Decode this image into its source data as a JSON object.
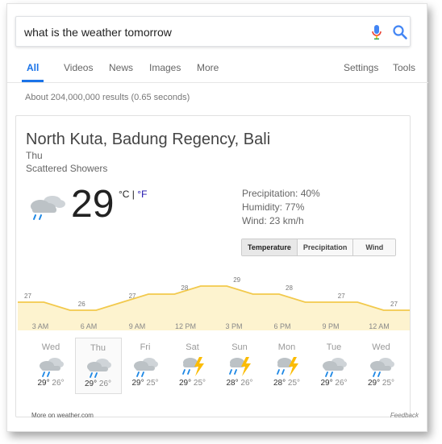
{
  "search": {
    "query": "what is the weather tomorrow"
  },
  "tabs": [
    {
      "label": "All"
    },
    {
      "label": "Videos"
    },
    {
      "label": "News"
    },
    {
      "label": "Images"
    },
    {
      "label": "More"
    }
  ],
  "tools": {
    "settings": "Settings",
    "tools": "Tools"
  },
  "result_stats": "About 204,000,000 results (0.65 seconds)",
  "weather": {
    "location": "North Kuta, Badung Regency, Bali",
    "day": "Thu",
    "condition": "Scattered Showers",
    "temperature": "29",
    "unit_c": "°C",
    "unit_sep": " | ",
    "unit_f": "°F",
    "precipitation": "Precipitation: 40%",
    "humidity": "Humidity: 77%",
    "wind": "Wind: 23 km/h",
    "toggle": [
      "Temperature",
      "Precipitation",
      "Wind"
    ]
  },
  "chart_data": {
    "type": "area",
    "x": [
      "12 AM",
      "3 AM",
      "6 AM",
      "9 AM",
      "12 PM",
      "3 PM",
      "6 PM",
      "9 PM",
      "12 AM"
    ],
    "hourly_temps": [
      27,
      27,
      26,
      26,
      27,
      28,
      28,
      29,
      29,
      28,
      28,
      27,
      27,
      27,
      26,
      26
    ],
    "labels": [
      {
        "hour": "12 AM",
        "value": "27"
      },
      {
        "hour": "3 AM",
        "value": "26"
      },
      {
        "hour": "9 AM",
        "value": "27"
      },
      {
        "hour": "12 PM",
        "value": "28"
      },
      {
        "hour": "3 PM",
        "value": "29"
      },
      {
        "hour": "6 PM",
        "value": "28"
      },
      {
        "hour": "9 PM",
        "value": "27"
      },
      {
        "hour": "12 AM",
        "value": "27"
      }
    ],
    "hour_labels": [
      "3 AM",
      "6 AM",
      "9 AM",
      "12 PM",
      "3 PM",
      "6 PM",
      "9 PM",
      "12 AM"
    ],
    "line_color": "#f2c94c",
    "fill_color": "#fdf3cf"
  },
  "forecast": [
    {
      "day": "Wed",
      "icon": "rain-cloud-icon",
      "hi": "29°",
      "lo": "26°"
    },
    {
      "day": "Thu",
      "icon": "rain-cloud-icon",
      "hi": "29°",
      "lo": "26°"
    },
    {
      "day": "Fri",
      "icon": "rain-cloud-icon",
      "hi": "29°",
      "lo": "25°"
    },
    {
      "day": "Sat",
      "icon": "thunderstorm-icon",
      "hi": "29°",
      "lo": "25°"
    },
    {
      "day": "Sun",
      "icon": "thunderstorm-icon",
      "hi": "28°",
      "lo": "26°"
    },
    {
      "day": "Mon",
      "icon": "thunderstorm-icon",
      "hi": "28°",
      "lo": "25°"
    },
    {
      "day": "Tue",
      "icon": "rain-cloud-icon",
      "hi": "29°",
      "lo": "26°"
    },
    {
      "day": "Wed",
      "icon": "rain-cloud-icon",
      "hi": "29°",
      "lo": "25°"
    }
  ],
  "footer": {
    "more": "More on weather.com",
    "feedback": "Feedback"
  }
}
